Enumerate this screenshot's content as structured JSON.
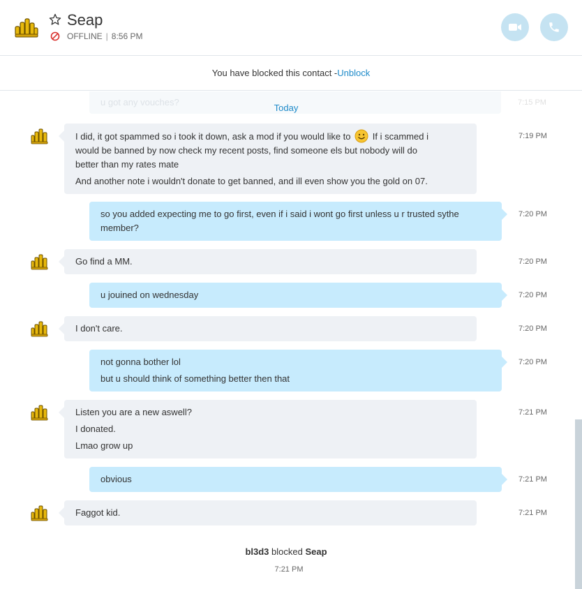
{
  "header": {
    "contact_name": "Seap",
    "status": "OFFLINE",
    "last_seen": "8:56 PM",
    "separator": "|",
    "accent_color": "#1d8ac9",
    "call_button_color": "#c5e3f2"
  },
  "blocked_notice": {
    "text": "You have blocked this contact - ",
    "unblock_label": "Unblock"
  },
  "chat": {
    "ghost_message": "u got any vouches?",
    "ghost_time": "7:15 PM",
    "date_divider": "Today",
    "messages": [
      {
        "direction": "incoming",
        "lines": [
          "I did, it got spammed so i took it down, ask a mod if you would like to",
          "If i scammed i",
          "would be banned by now check my recent posts, find someone els but nobody will do",
          "better than my rates mate",
          "And another note i wouldn't donate to get banned, and ill even show you the gold on 07."
        ],
        "time": "7:19 PM"
      },
      {
        "direction": "outgoing",
        "lines": [
          "so you added expecting me  to go first, even if i said i wont go first unless u r trusted sythe",
          "member?"
        ],
        "time": "7:20 PM"
      },
      {
        "direction": "incoming",
        "lines": [
          "Go find a MM."
        ],
        "time": "7:20 PM"
      },
      {
        "direction": "outgoing",
        "lines": [
          "u jouined on wednesday"
        ],
        "time": "7:20 PM"
      },
      {
        "direction": "incoming",
        "lines": [
          "I don't care."
        ],
        "time": "7:20 PM"
      },
      {
        "direction": "outgoing",
        "lines": [
          "not gonna bother lol",
          "but u should think of something better then that"
        ],
        "time": "7:20 PM"
      },
      {
        "direction": "incoming",
        "lines": [
          "Listen you are a new aswell?",
          "I donated.",
          "Lmao grow up"
        ],
        "time": "7:21 PM"
      },
      {
        "direction": "outgoing",
        "lines": [
          "obvious"
        ],
        "time": "7:21 PM"
      },
      {
        "direction": "incoming",
        "lines": [
          "Faggot kid."
        ],
        "time": "7:21 PM"
      }
    ],
    "system_event": {
      "actor": "bl3d3",
      "action": " blocked ",
      "target": "Seap",
      "time": "7:21 PM"
    }
  }
}
